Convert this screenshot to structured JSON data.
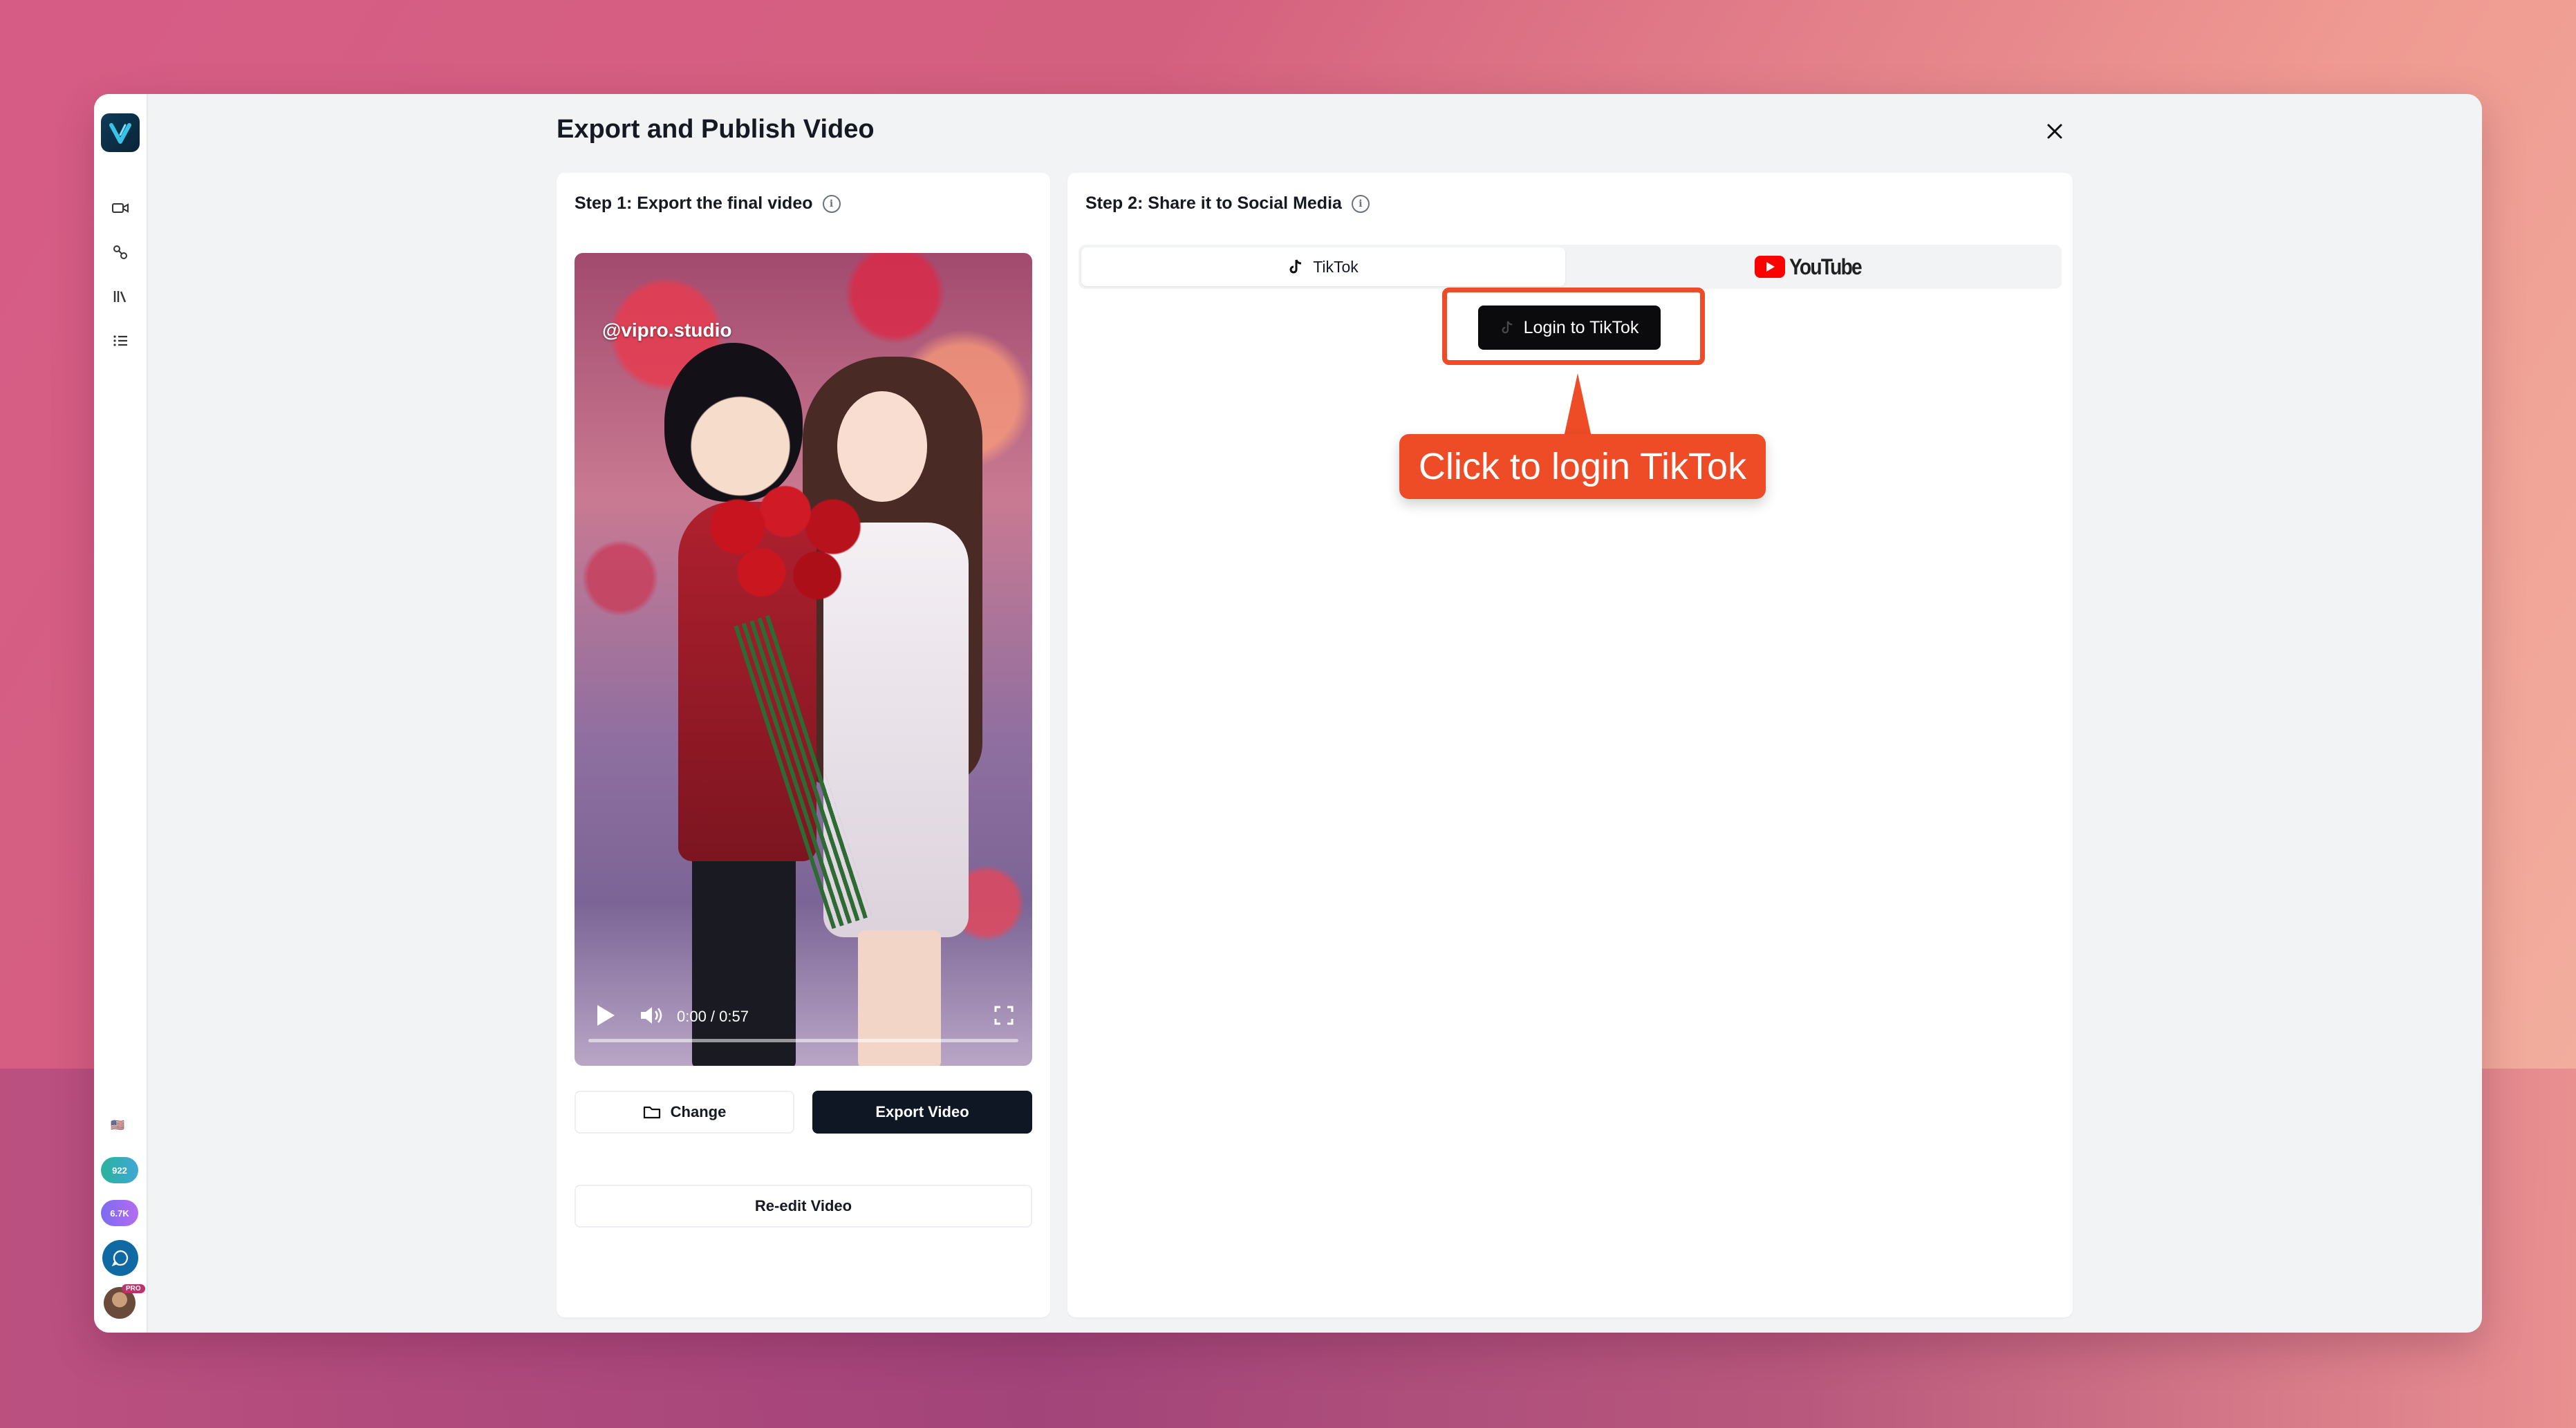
{
  "modal": {
    "title": "Export and Publish Video"
  },
  "step1": {
    "title": "Step 1: Export the final video",
    "video": {
      "watermark": "@vipro.studio",
      "time": "0:00 / 0:57",
      "progress": 0
    },
    "change_label": "Change",
    "export_label": "Export Video",
    "reedit_label": "Re-edit Video"
  },
  "step2": {
    "title": "Step 2: Share it to Social Media",
    "tabs": [
      {
        "label": "TikTok",
        "icon": "tiktok-icon",
        "active": true
      },
      {
        "label": "YouTube",
        "icon": "youtube-logo",
        "active": false
      }
    ],
    "login_label": "Login to TikTok"
  },
  "annotation": {
    "callout_text": "Click to login TikTok",
    "color": "#ee4c26"
  },
  "sidebar": {
    "items": [
      {
        "icon": "video-camera-icon"
      },
      {
        "icon": "workflow-icon"
      },
      {
        "icon": "library-icon"
      },
      {
        "icon": "list-icon"
      }
    ],
    "language_flag": "🇺🇸",
    "credits": [
      {
        "value": "922",
        "color": "#2bb39a"
      },
      {
        "value": "6.7K",
        "color": "#7b6cf0"
      }
    ],
    "avatar_badge": "PRO"
  },
  "colors": {
    "dark_button": "#0f1624",
    "accent": "#ee4c26"
  }
}
